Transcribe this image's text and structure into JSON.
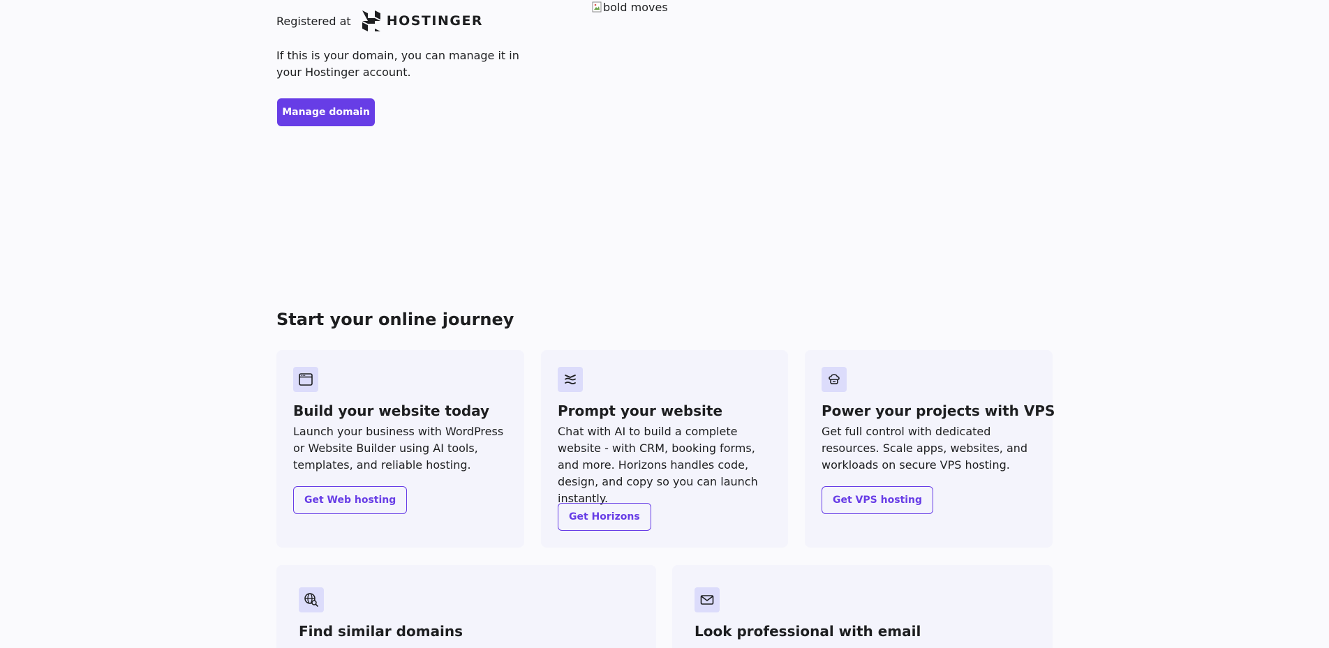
{
  "registrar": {
    "label": "Registered at",
    "logo_text": "HOSTINGER"
  },
  "manage": {
    "text": "If this is your domain, you can manage it in your Hostinger account.",
    "button_label": "Manage domain"
  },
  "hero_image": {
    "alt": "bold moves"
  },
  "journey": {
    "title": "Start your online journey",
    "cards": [
      {
        "icon": "browser-window-icon",
        "title": "Build your website today",
        "description": "Launch your business with WordPress or Website Builder using AI tools, templates, and reliable hosting.",
        "button_label": "Get Web hosting"
      },
      {
        "icon": "horizons-waves-icon",
        "title": "Prompt your website",
        "description": "Chat with AI to build a complete website - with CRM, booking forms, and more. Horizons handles code, design, and copy so you can launch instantly.",
        "button_label": "Get Horizons"
      },
      {
        "icon": "cloud-server-icon",
        "title": "Power your projects with VPS",
        "description": "Get full control with dedicated resources. Scale apps, websites, and workloads on secure VPS hosting.",
        "button_label": "Get VPS hosting"
      },
      {
        "icon": "globe-search-icon",
        "title": "Find similar domains"
      },
      {
        "icon": "envelope-icon",
        "title": "Look professional with email"
      }
    ]
  },
  "colors": {
    "accent": "#673de6",
    "background": "#fafafd",
    "card_background": "#f4f4fc",
    "icon_background": "#dcdcfb",
    "text": "#1d1e20"
  }
}
